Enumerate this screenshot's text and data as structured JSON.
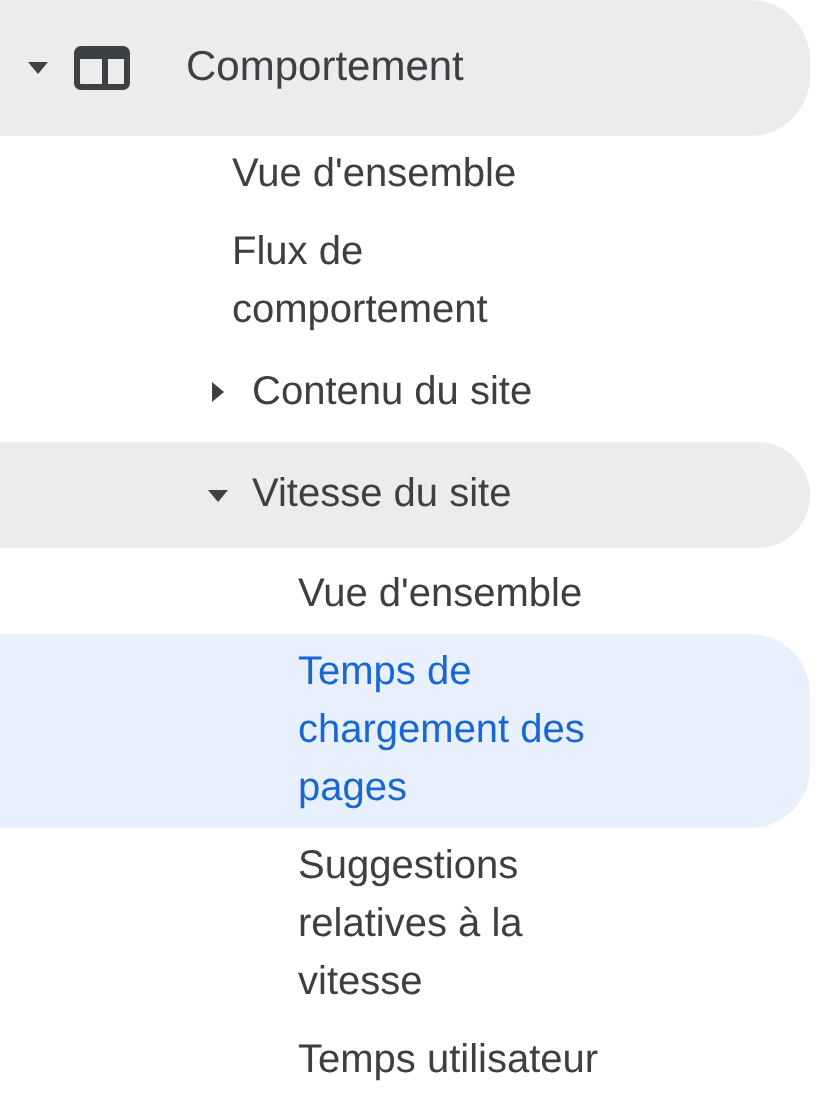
{
  "nav": [
    {
      "label": "Comportement",
      "expanded": true,
      "selected": false,
      "children": [
        {
          "label": "Vue d'ensemble",
          "selected": false
        },
        {
          "label": "Flux de comportement",
          "selected": false
        },
        {
          "label": "Contenu du site",
          "expanded": false,
          "selected": false
        },
        {
          "label": "Vitesse du site",
          "expanded": true,
          "selected": false,
          "children": [
            {
              "label": "Vue d'ensemble",
              "selected": false
            },
            {
              "label": "Temps de chargement des pages",
              "selected": true
            },
            {
              "label": "Suggestions relatives à la vitesse",
              "selected": false
            },
            {
              "label": "Temps utilisateur",
              "selected": false
            }
          ]
        }
      ]
    }
  ]
}
